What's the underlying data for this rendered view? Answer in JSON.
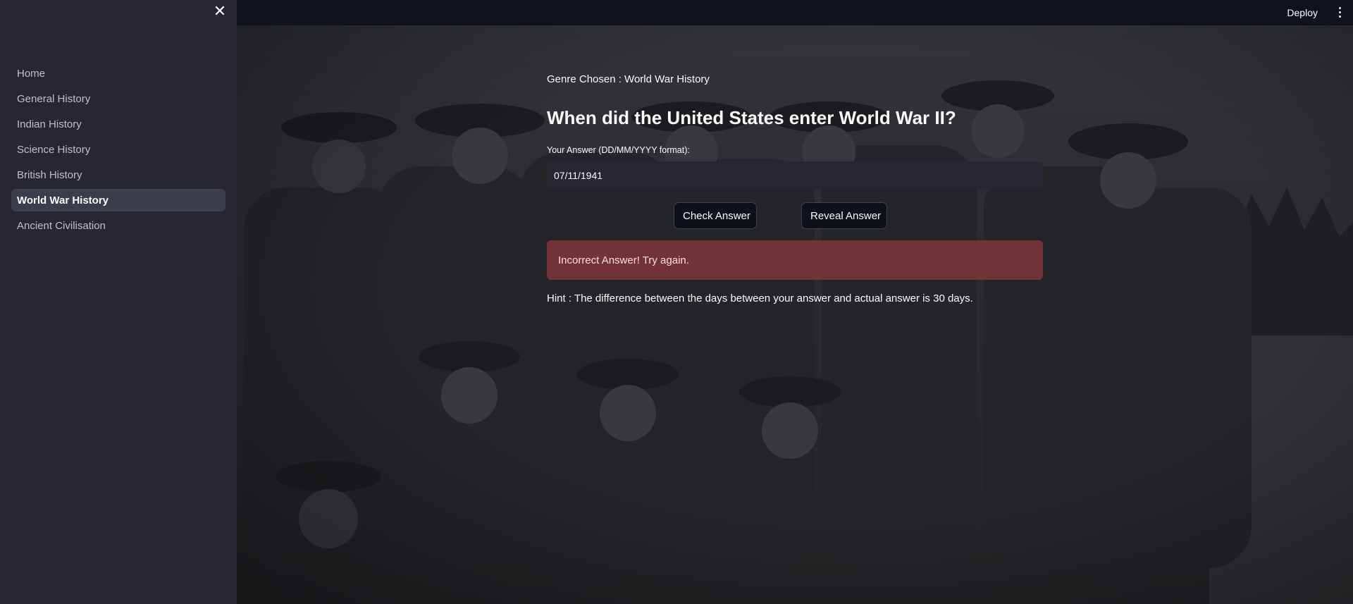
{
  "sidebar": {
    "close_glyph": "✕",
    "items": [
      {
        "label": "Home",
        "active": false
      },
      {
        "label": "General History",
        "active": false
      },
      {
        "label": "Indian History",
        "active": false
      },
      {
        "label": "Science History",
        "active": false
      },
      {
        "label": "British History",
        "active": false
      },
      {
        "label": "World War History",
        "active": true
      },
      {
        "label": "Ancient Civilisation",
        "active": false
      }
    ]
  },
  "topbar": {
    "deploy_label": "Deploy",
    "menu_icon": "vertical-dots-icon"
  },
  "main": {
    "genre": "Genre Chosen : World War History",
    "question": "When did the United States enter World War II?",
    "answer_label": "Your Answer (DD/MM/YYYY format):",
    "answer_value": "07/11/1941",
    "check_button": "Check Answer",
    "reveal_button": "Reveal Answer",
    "alert_text": "Incorrect Answer! Try again.",
    "hint_text": "Hint : The difference between the days between your answer and actual answer is 30 days."
  },
  "colors": {
    "sidebar_bg": "#262730",
    "topbar_bg": "#0f131b",
    "active_item_bg": "#3b3d4a",
    "error_alert_bg": "#7d353a",
    "input_bg": "#262730"
  }
}
